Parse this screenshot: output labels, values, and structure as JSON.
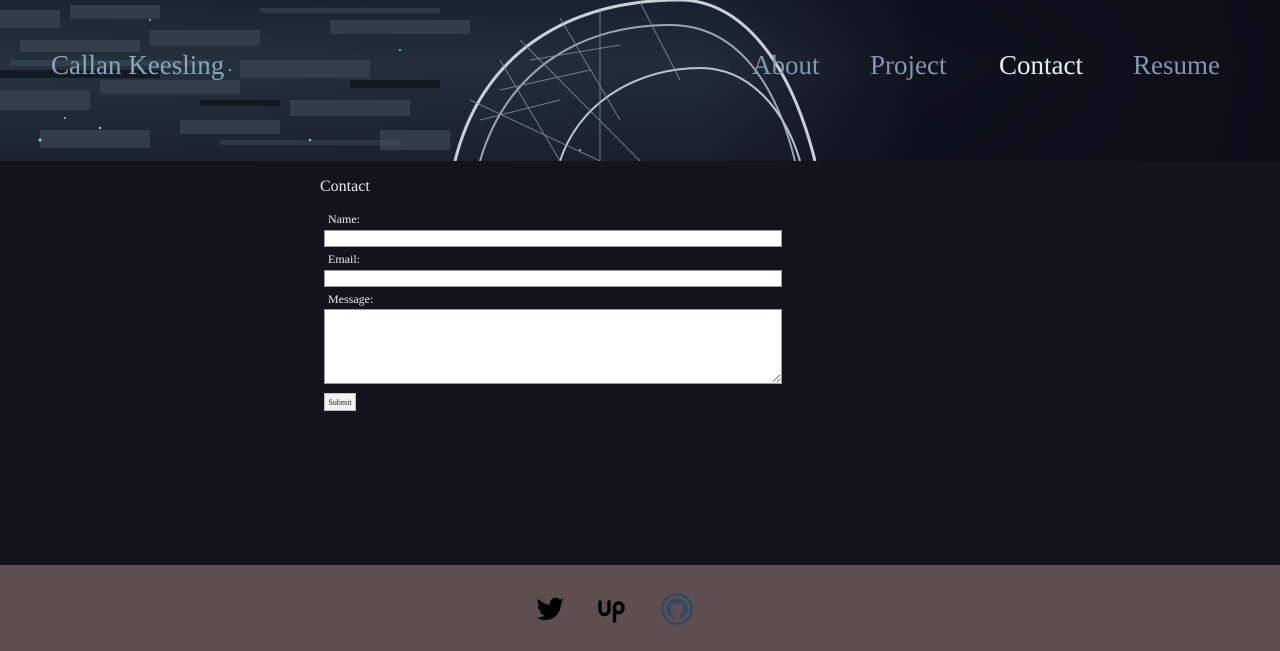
{
  "header": {
    "brand": "Callan Keesling",
    "nav": [
      "About",
      "Project",
      "Contact",
      "Resume"
    ],
    "active_nav": "Contact"
  },
  "contact": {
    "title": "Contact",
    "name_label": "Name:",
    "name_value": "",
    "email_label": "Email:",
    "email_value": "",
    "message_label": "Message:",
    "message_value": "",
    "submit_label": "Submit"
  },
  "footer": {
    "icons": [
      "twitter-icon",
      "upwork-icon",
      "github-icon"
    ]
  },
  "colors": {
    "background": "#13121d",
    "footer": "#5e4e51",
    "nav_text": "#7f98ad",
    "nav_active": "#e6ecf2"
  }
}
